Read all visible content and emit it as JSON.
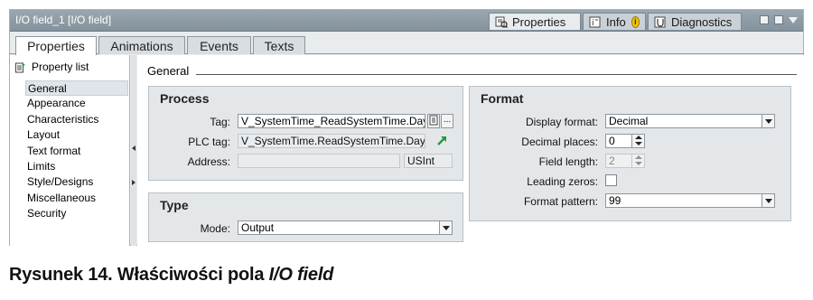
{
  "window": {
    "title": "I/O field_1 [I/O field]",
    "inspector_tabs": [
      {
        "label": "Properties",
        "icon": "properties-icon",
        "active": true
      },
      {
        "label": "Info",
        "icon": "info-icon",
        "badge": "i",
        "active": false
      },
      {
        "label": "Diagnostics",
        "icon": "diagnostics-icon",
        "active": false
      }
    ]
  },
  "subtabs": [
    {
      "label": "Properties",
      "active": true
    },
    {
      "label": "Animations",
      "active": false
    },
    {
      "label": "Events",
      "active": false
    },
    {
      "label": "Texts",
      "active": false
    }
  ],
  "sidebar": {
    "header": "Property list",
    "items": [
      "General",
      "Appearance",
      "Characteristics",
      "Layout",
      "Text format",
      "Limits",
      "Style/Designs",
      "Miscellaneous",
      "Security"
    ],
    "selected": "General"
  },
  "section": {
    "title": "General"
  },
  "process": {
    "title": "Process",
    "tag_label": "Tag:",
    "tag_value": "V_SystemTime_ReadSystemTime.Day",
    "tag_browse": "...",
    "plc_tag_label": "PLC tag:",
    "plc_tag_value": "V_SystemTime.ReadSystemTime.Day",
    "address_label": "Address:",
    "address_value": "",
    "address_type": "USInt"
  },
  "type": {
    "title": "Type",
    "mode_label": "Mode:",
    "mode_value": "Output"
  },
  "format": {
    "title": "Format",
    "display_format_label": "Display format:",
    "display_format_value": "Decimal",
    "decimal_places_label": "Decimal places:",
    "decimal_places_value": "0",
    "field_length_label": "Field length:",
    "field_length_value": "2",
    "leading_zeros_label": "Leading zeros:",
    "leading_zeros_checked": false,
    "format_pattern_label": "Format pattern:",
    "format_pattern_value": "99"
  },
  "caption": {
    "prefix": "Rysunek 14. Właściwości pola ",
    "italic": "I/O field"
  },
  "colors": {
    "titlebar": "#8f9ca5",
    "panel": "#e4e7ea",
    "accent_arrow": "#1e9a3a",
    "info_badge": "#f2c200"
  }
}
